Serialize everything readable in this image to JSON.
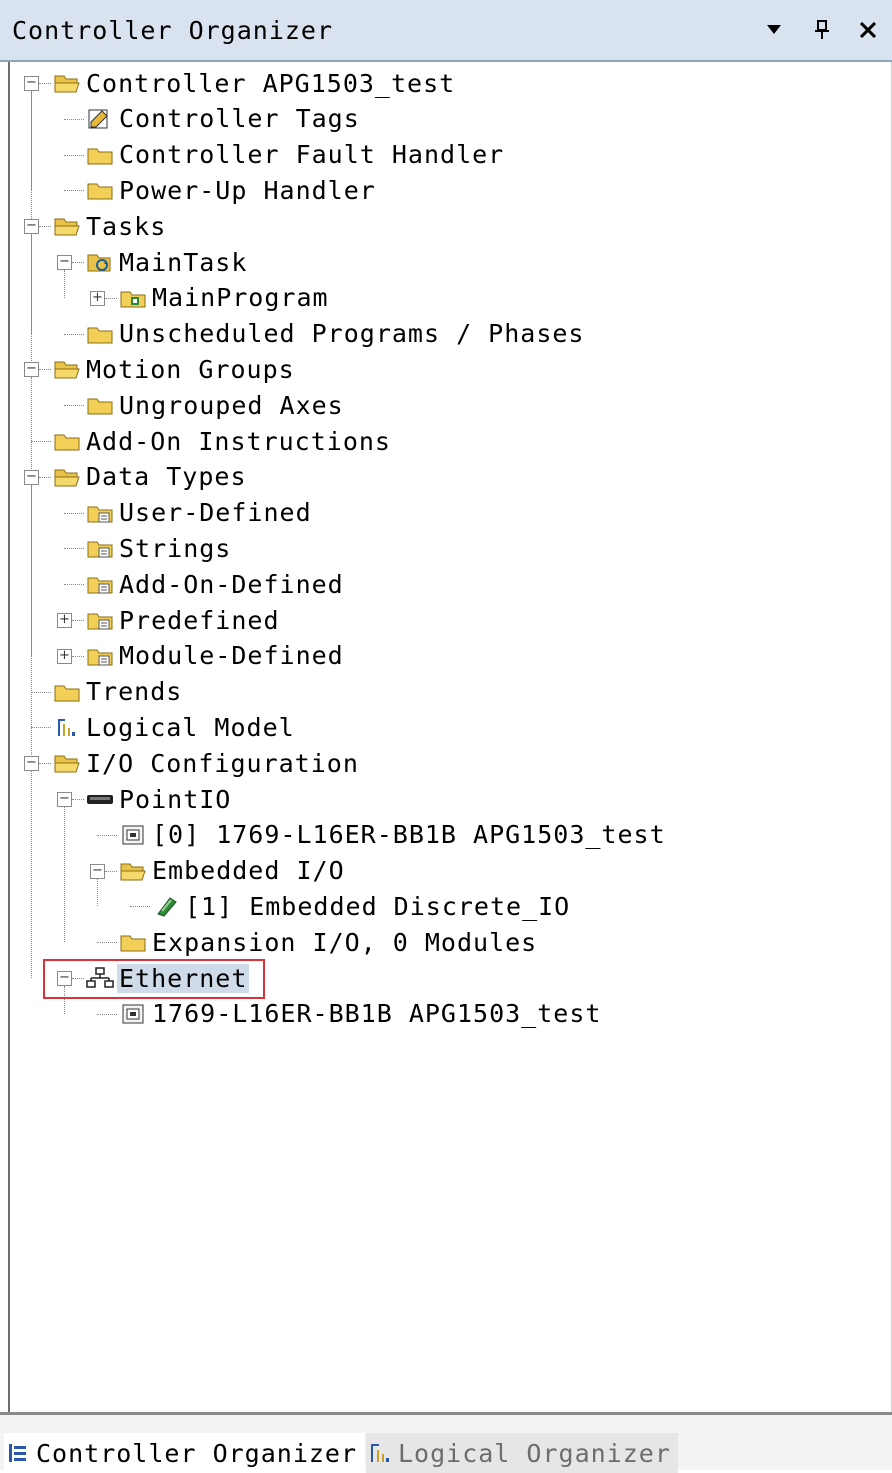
{
  "window": {
    "title": "Controller Organizer",
    "buttons": {
      "dropdown": "▾",
      "pin": "ᵖ",
      "close": "✕"
    }
  },
  "tree": [
    {
      "label": "Controller APG1503_test",
      "icon": "folder-open-icon",
      "expander": "minus"
    },
    {
      "label": "Controller Tags",
      "icon": "tags-icon"
    },
    {
      "label": "Controller Fault Handler",
      "icon": "folder-icon"
    },
    {
      "label": "Power-Up Handler",
      "icon": "folder-icon"
    },
    {
      "label": "Tasks",
      "icon": "folder-open-icon",
      "expander": "minus"
    },
    {
      "label": "MainTask",
      "icon": "task-icon",
      "expander": "minus"
    },
    {
      "label": "MainProgram",
      "icon": "program-icon",
      "expander": "plus"
    },
    {
      "label": "Unscheduled Programs / Phases",
      "icon": "folder-icon"
    },
    {
      "label": "Motion Groups",
      "icon": "folder-open-icon",
      "expander": "minus"
    },
    {
      "label": "Ungrouped Axes",
      "icon": "folder-icon"
    },
    {
      "label": "Add-On Instructions",
      "icon": "folder-icon"
    },
    {
      "label": "Data Types",
      "icon": "folder-open-icon",
      "expander": "minus"
    },
    {
      "label": "User-Defined",
      "icon": "datatype-folder-icon"
    },
    {
      "label": "Strings",
      "icon": "datatype-folder-icon"
    },
    {
      "label": "Add-On-Defined",
      "icon": "datatype-folder-icon"
    },
    {
      "label": "Predefined",
      "icon": "datatype-folder-icon",
      "expander": "plus"
    },
    {
      "label": "Module-Defined",
      "icon": "datatype-folder-icon",
      "expander": "plus"
    },
    {
      "label": "Trends",
      "icon": "folder-icon"
    },
    {
      "label": "Logical Model",
      "icon": "logical-model-icon"
    },
    {
      "label": "I/O Configuration",
      "icon": "folder-open-icon",
      "expander": "minus"
    },
    {
      "label": "PointIO",
      "icon": "backplane-icon",
      "expander": "minus"
    },
    {
      "label": "[0] 1769-L16ER-BB1B APG1503_test",
      "icon": "module-icon"
    },
    {
      "label": "Embedded I/O",
      "icon": "folder-open-icon",
      "expander": "minus"
    },
    {
      "label": "[1] Embedded Discrete_IO",
      "icon": "io-module-icon"
    },
    {
      "label": "Expansion I/O, 0 Modules",
      "icon": "folder-icon"
    },
    {
      "label": "Ethernet",
      "icon": "network-icon",
      "expander": "minus",
      "selected": true
    },
    {
      "label": "1769-L16ER-BB1B APG1503_test",
      "icon": "module-icon"
    }
  ],
  "tabs": [
    {
      "label": "Controller Organizer",
      "icon": "controller-organizer-icon",
      "active": true
    },
    {
      "label": "Logical Organizer",
      "icon": "logical-organizer-icon",
      "active": false
    }
  ],
  "colors": {
    "folder": "#f2cf57",
    "selection": "#cfdbe9",
    "highlight_border": "#d9333a",
    "titlebar": "#d9e3f0"
  }
}
